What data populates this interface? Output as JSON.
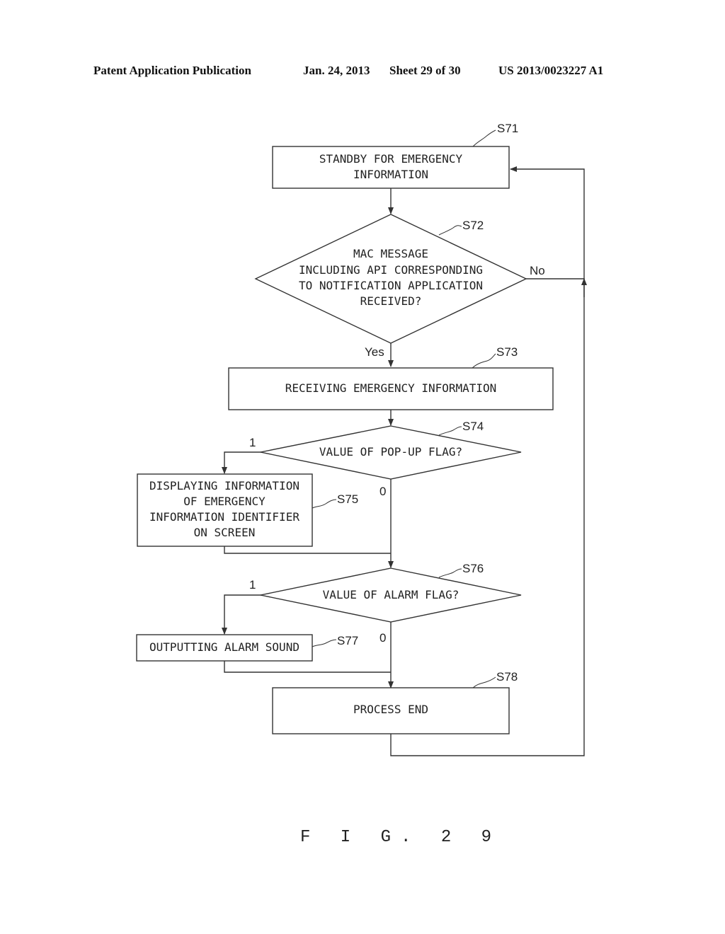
{
  "header": {
    "publication": "Patent Application Publication",
    "date": "Jan. 24, 2013",
    "sheet": "Sheet 29 of 30",
    "number": "US 2013/0023227 A1"
  },
  "figure_label": "F I G. 2 9",
  "steps": {
    "s71": {
      "id": "S71",
      "type": "process",
      "lines": [
        "STANDBY FOR EMERGENCY",
        "INFORMATION"
      ]
    },
    "s72": {
      "id": "S72",
      "type": "decision",
      "lines": [
        "MAC MESSAGE",
        "INCLUDING API CORRESPONDING",
        "TO NOTIFICATION APPLICATION",
        "RECEIVED?"
      ]
    },
    "s73": {
      "id": "S73",
      "type": "process",
      "lines": [
        "RECEIVING EMERGENCY INFORMATION"
      ]
    },
    "s74": {
      "id": "S74",
      "type": "decision",
      "lines": [
        "VALUE OF POP-UP FLAG?"
      ]
    },
    "s75": {
      "id": "S75",
      "type": "process",
      "lines": [
        "DISPLAYING INFORMATION",
        "OF EMERGENCY",
        "INFORMATION IDENTIFIER",
        "ON SCREEN"
      ]
    },
    "s76": {
      "id": "S76",
      "type": "decision",
      "lines": [
        "VALUE OF ALARM FLAG?"
      ]
    },
    "s77": {
      "id": "S77",
      "type": "process",
      "lines": [
        "OUTPUTTING ALARM SOUND"
      ]
    },
    "s78": {
      "id": "S78",
      "type": "process",
      "lines": [
        "PROCESS END"
      ]
    }
  },
  "edge_labels": {
    "s72_no": "No",
    "s72_yes": "Yes",
    "s74_one": "1",
    "s74_zero": "0",
    "s76_one": "1",
    "s76_zero": "0"
  }
}
